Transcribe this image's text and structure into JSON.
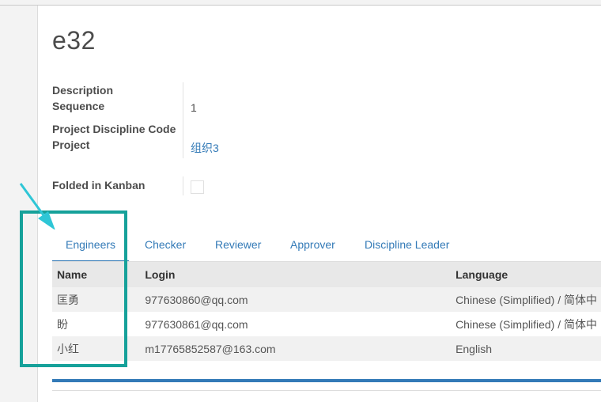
{
  "record": {
    "title": "e32"
  },
  "fields": {
    "description_label": "Description",
    "sequence_label": "Sequence",
    "sequence_value": "1",
    "discipline_code_label": "Project Discipline Code",
    "project_label": "Project",
    "project_value": "组织3",
    "folded_label": "Folded in Kanban"
  },
  "tabs": [
    "Engineers",
    "Checker",
    "Reviewer",
    "Approver",
    "Discipline Leader"
  ],
  "table": {
    "headers": [
      "Name",
      "Login",
      "Language"
    ],
    "rows": [
      [
        "匡勇",
        "977630860@qq.com",
        "Chinese (Simplified) / 简体中"
      ],
      [
        "盼",
        "977630861@qq.com",
        "Chinese (Simplified) / 简体中"
      ],
      [
        "小红",
        "m17765852587@163.com",
        "English"
      ]
    ]
  },
  "colors": {
    "accent": "#337ab7",
    "highlight": "#16a19a"
  }
}
